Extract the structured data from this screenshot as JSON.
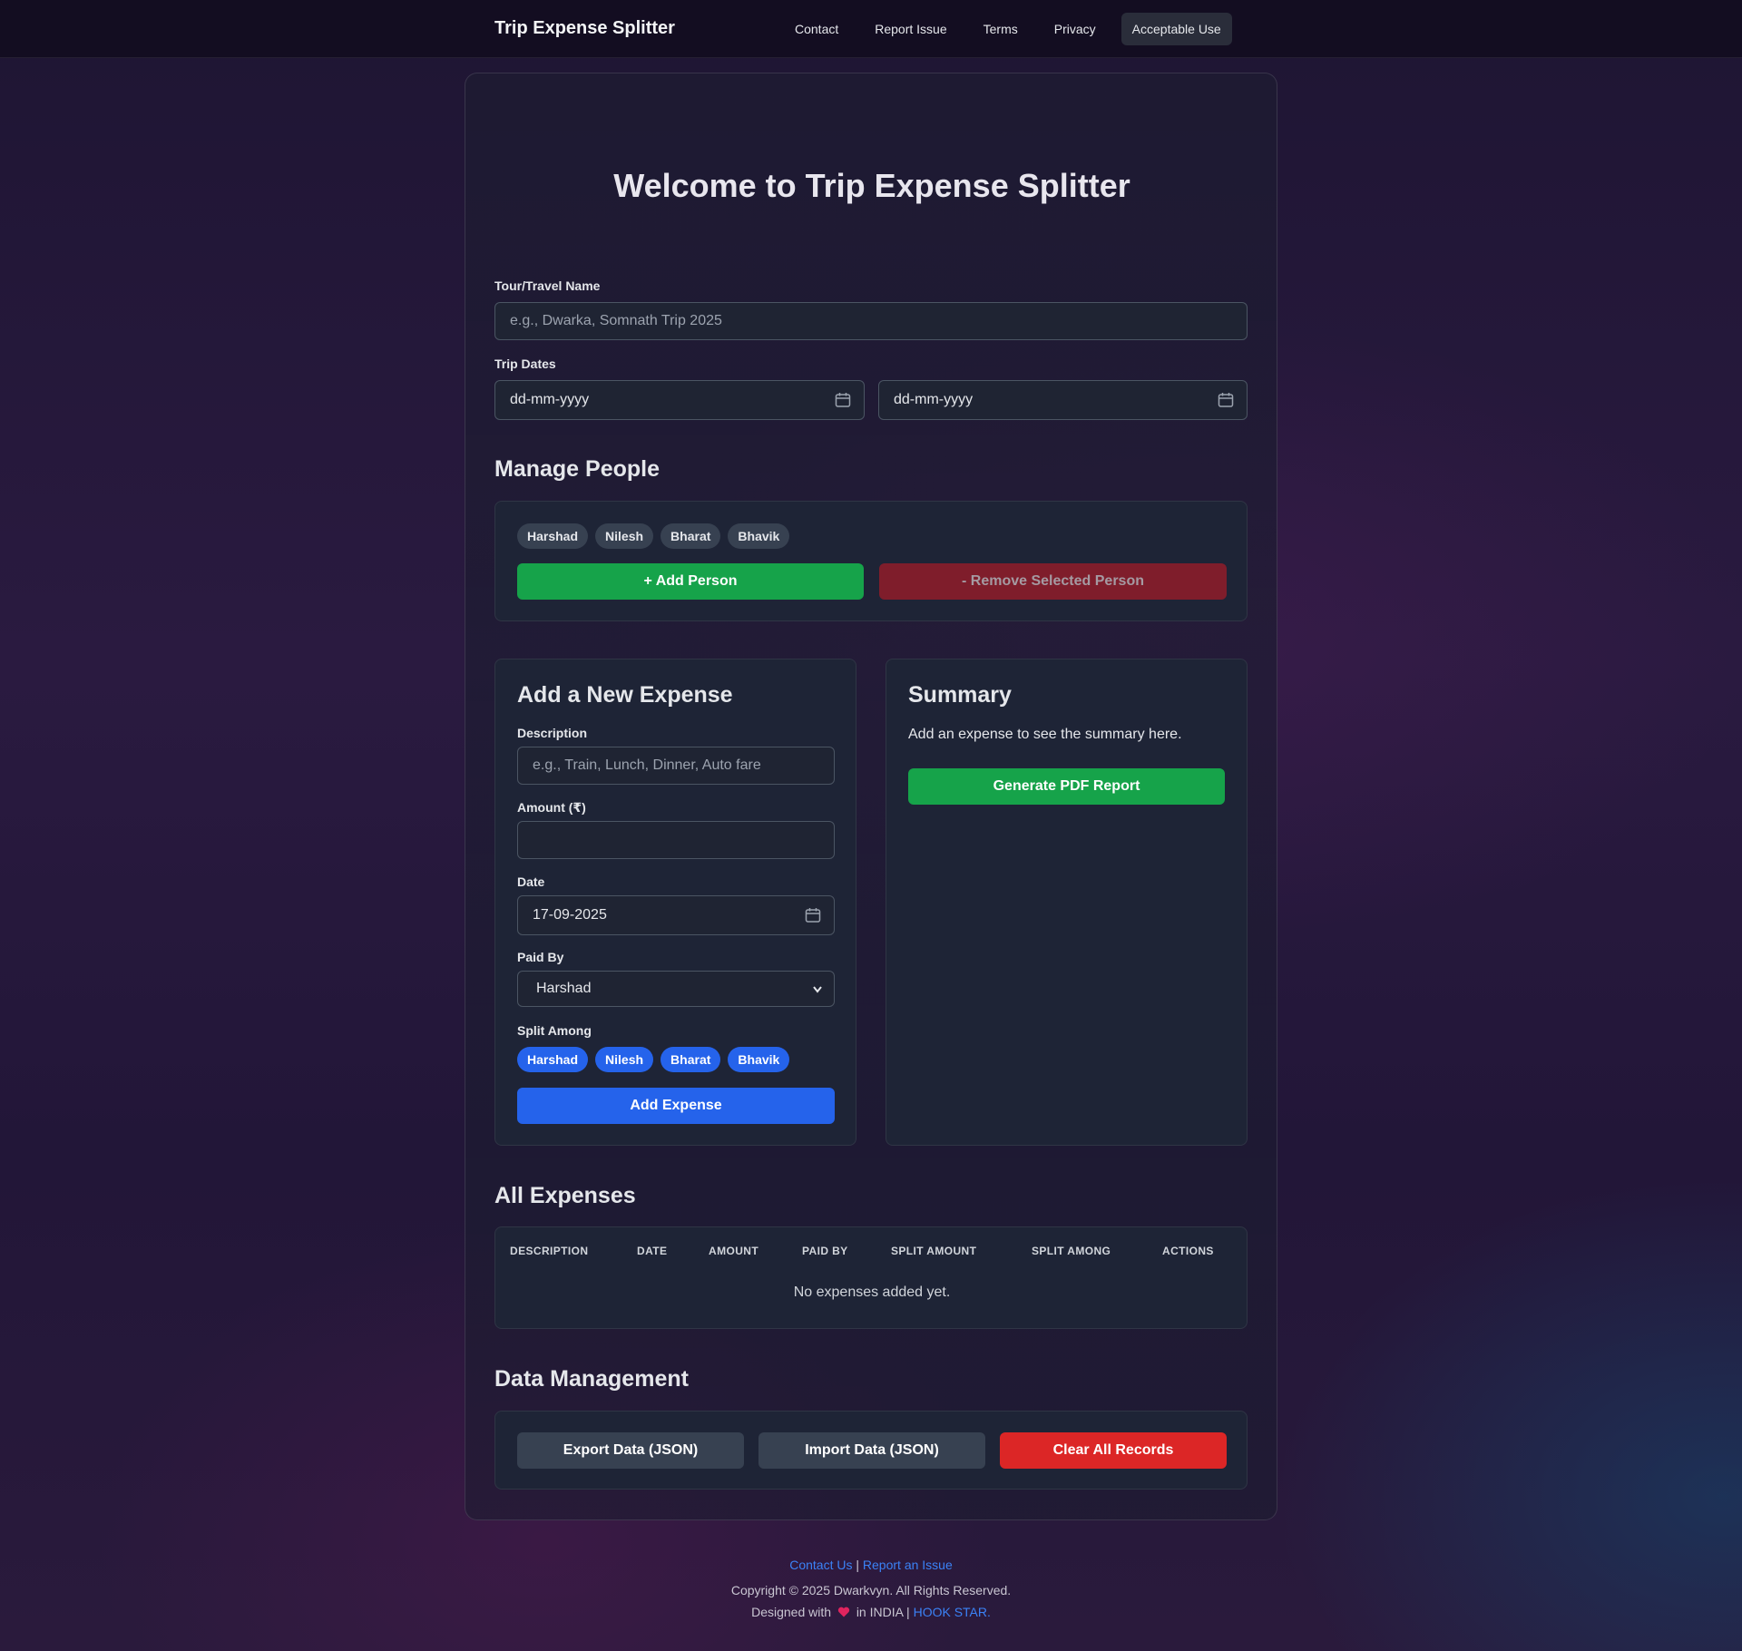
{
  "navbar": {
    "brand": "Trip Expense Splitter",
    "links": [
      "Contact",
      "Report Issue",
      "Terms",
      "Privacy",
      "Acceptable Use"
    ]
  },
  "main": {
    "title": "Welcome to Trip Expense Splitter",
    "tour_label": "Tour/Travel Name",
    "tour_placeholder": "e.g., Dwarka, Somnath Trip 2025",
    "dates_label": "Trip Dates",
    "start_date": "dd-mm-yyyy",
    "end_date": "dd-mm-yyyy"
  },
  "people": {
    "heading": "Manage People",
    "names": [
      "Harshad",
      "Nilesh",
      "Bharat",
      "Bhavik"
    ],
    "add_button": "+ Add Person",
    "remove_button": "- Remove Selected Person"
  },
  "expense_form": {
    "heading": "Add a New Expense",
    "description_label": "Description",
    "description_placeholder": "e.g., Train, Lunch, Dinner, Auto fare",
    "amount_label": "Amount (₹)",
    "amount_value": "",
    "date_label": "Date",
    "date_value": "17-09-2025",
    "paid_by_label": "Paid By",
    "paid_by_value": "Harshad",
    "split_label": "Split Among",
    "split_names": [
      "Harshad",
      "Nilesh",
      "Bharat",
      "Bhavik"
    ],
    "submit": "Add Expense"
  },
  "summary": {
    "heading": "Summary",
    "empty_text": "Add an expense to see the summary here.",
    "pdf_button": "Generate PDF Report"
  },
  "expenses_table": {
    "heading": "All Expenses",
    "columns": [
      "DESCRIPTION",
      "DATE",
      "AMOUNT",
      "PAID BY",
      "SPLIT AMOUNT",
      "SPLIT AMONG",
      "ACTIONS"
    ],
    "empty_text": "No expenses added yet."
  },
  "data_management": {
    "heading": "Data Management",
    "export": "Export Data (JSON)",
    "import": "Import Data (JSON)",
    "clear": "Clear All Records"
  },
  "footer": {
    "contact": "Contact Us",
    "separator": "|",
    "report": "Report an Issue",
    "copyright": "Copyright © 2025 Dwarkvyn. All Rights Reserved.",
    "designed_prefix": "Designed with",
    "designed_middle": "in INDIA |",
    "designer": "HOOK STAR."
  },
  "colors": {
    "accent_green": "#16a34a",
    "accent_blue": "#2563eb",
    "accent_red": "#dc2626"
  }
}
